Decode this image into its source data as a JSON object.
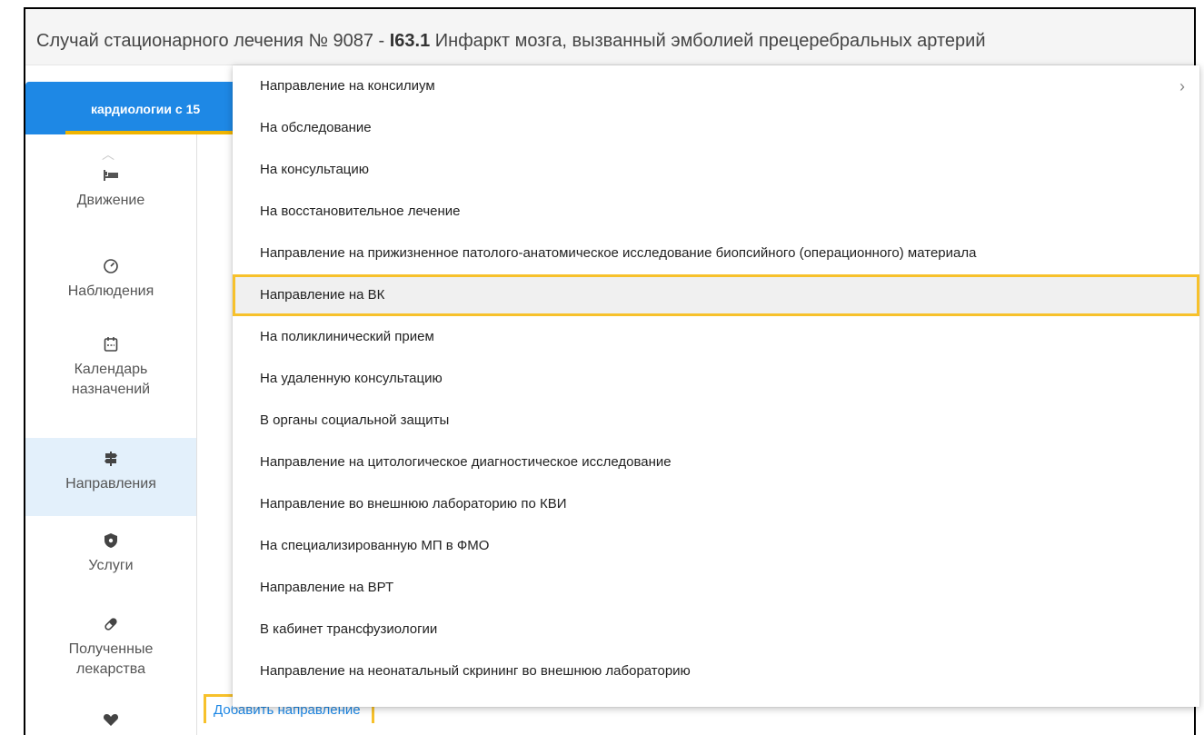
{
  "header": {
    "title_prefix": "Случай стационарного лечения № 9087 - ",
    "title_code": "I63.1",
    "title_suffix": " Инфаркт мозга, вызванный эмболией прецеребральных артерий"
  },
  "tab": {
    "label": "кардиологии с 15"
  },
  "sidebar": {
    "items": [
      {
        "label": "Движение",
        "icon": "bed-icon"
      },
      {
        "label": "Наблюдения",
        "icon": "gauge-icon"
      },
      {
        "label": "Календарь назначений",
        "icon": "calendar-icon"
      },
      {
        "label": "Направления",
        "icon": "signpost-icon",
        "active": true
      },
      {
        "label": "Услуги",
        "icon": "shield-icon"
      },
      {
        "label": "Полученные лекарства",
        "icon": "pill-icon"
      },
      {
        "label": "",
        "icon": "heart-handshake-icon"
      }
    ]
  },
  "menu": {
    "items": [
      {
        "label": "Направление на консилиум",
        "submenu": true
      },
      {
        "label": "На обследование"
      },
      {
        "label": "На консультацию"
      },
      {
        "label": "На восстановительное лечение"
      },
      {
        "label": "Направление на прижизненное патолого-анатомическое исследование биопсийного (операционного) материала"
      },
      {
        "label": "Направление на ВК",
        "highlighted": true
      },
      {
        "label": "На поликлинический прием"
      },
      {
        "label": "На удаленную консультацию"
      },
      {
        "label": "В органы социальной защиты"
      },
      {
        "label": "Направление на цитологическое диагностическое исследование"
      },
      {
        "label": "Направление во внешнюю лабораторию по КВИ"
      },
      {
        "label": "На специализированную МП в ФМО"
      },
      {
        "label": "Направление на ВРТ"
      },
      {
        "label": "В кабинет трансфузиологии"
      },
      {
        "label": "Направление на неонатальный скрининг во внешнюю лабораторию"
      }
    ]
  },
  "add_link": {
    "label": "Добавить направление"
  },
  "colors": {
    "accent": "#1e88e5",
    "highlight_border": "#f7c12b",
    "tab_underline": "#f0b400"
  }
}
